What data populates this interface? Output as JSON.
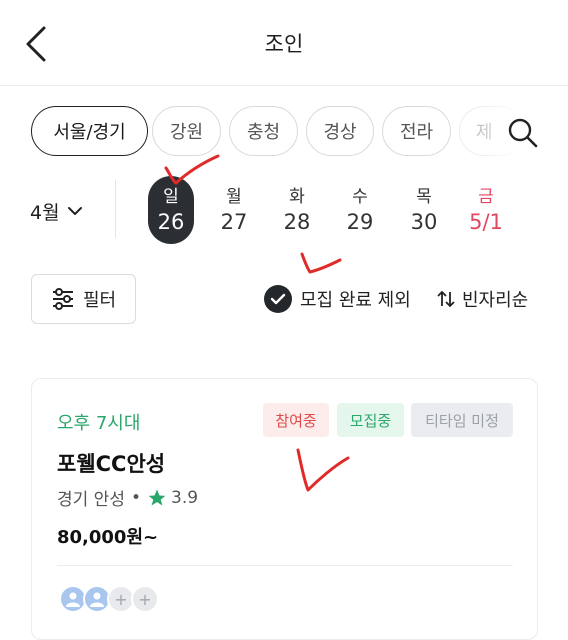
{
  "header": {
    "title": "조인",
    "back_icon": "back-arrow-icon"
  },
  "regions": {
    "items": [
      {
        "label": "서울/경기",
        "active": true
      },
      {
        "label": "강원",
        "active": false
      },
      {
        "label": "충청",
        "active": false
      },
      {
        "label": "경상",
        "active": false
      },
      {
        "label": "전라",
        "active": false
      },
      {
        "label": "제",
        "active": false
      }
    ],
    "search_icon": "search-icon"
  },
  "calendar": {
    "month_label": "4월",
    "days": [
      {
        "dow": "일",
        "num": "26",
        "selected": true,
        "holiday": false
      },
      {
        "dow": "월",
        "num": "27",
        "selected": false,
        "holiday": false
      },
      {
        "dow": "화",
        "num": "28",
        "selected": false,
        "holiday": false
      },
      {
        "dow": "수",
        "num": "29",
        "selected": false,
        "holiday": false
      },
      {
        "dow": "목",
        "num": "30",
        "selected": false,
        "holiday": false
      },
      {
        "dow": "금",
        "num": "5/1",
        "selected": false,
        "holiday": true
      }
    ],
    "holiday_color": "#e0485f",
    "selected_color": "#2b2f33"
  },
  "filters": {
    "filter_label": "필터",
    "exclude_label": "모집 완료 제외",
    "exclude_checked": true,
    "sort_label": "빈자리순"
  },
  "card": {
    "time": "오후 7시대",
    "badges": {
      "joined": "참여중",
      "recruiting": "모집중",
      "teetime": "티타임 미정"
    },
    "course": "포웰CC안성",
    "location": "경기 안성",
    "separator": "•",
    "rating": "3.9",
    "price": "80,000원~",
    "slots": {
      "filled": 2,
      "empty": 2
    },
    "empty_slot_symbol": "+",
    "accent_color": "#2aa86b"
  }
}
